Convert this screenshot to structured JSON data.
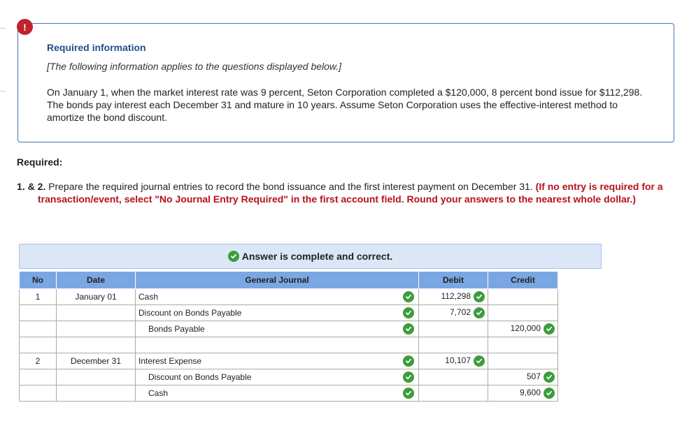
{
  "alert": {
    "icon": "exclamation-icon",
    "symbol": "!"
  },
  "info": {
    "title": "Required information",
    "note": "[The following information applies to the questions displayed below.]",
    "body": "On January 1, when the market interest rate was 9 percent, Seton Corporation completed a $120,000, 8 percent bond issue for $112,298. The bonds pay interest each December 31 and mature in 10 years. Assume Seton Corporation uses the effective-interest method to amortize the bond discount."
  },
  "required": {
    "heading": "Required:",
    "number": "1. & 2.",
    "text": " Prepare the required journal entries to record the bond issuance and the first interest payment on December 31. ",
    "instruction": "(If no entry is required for a transaction/event, select \"No Journal Entry Required\" in the first account field. Round your answers to the nearest whole dollar.)"
  },
  "answer": {
    "status": "Answer is complete and correct."
  },
  "journal": {
    "headers": {
      "no": "No",
      "date": "Date",
      "account": "General Journal",
      "debit": "Debit",
      "credit": "Credit"
    },
    "rows": [
      {
        "no": "1",
        "date": "January 01",
        "account": "Cash",
        "indent": false,
        "check": true,
        "debit": "112,298",
        "credit": ""
      },
      {
        "no": "",
        "date": "",
        "account": "Discount on Bonds Payable",
        "indent": false,
        "check": true,
        "debit": "7,702",
        "credit": ""
      },
      {
        "no": "",
        "date": "",
        "account": "Bonds Payable",
        "indent": true,
        "check": true,
        "debit": "",
        "credit": "120,000"
      },
      {
        "no": "",
        "date": "",
        "account": "",
        "indent": false,
        "check": false,
        "debit": "",
        "credit": ""
      },
      {
        "no": "2",
        "date": "December 31",
        "account": "Interest Expense",
        "indent": false,
        "check": true,
        "debit": "10,107",
        "credit": ""
      },
      {
        "no": "",
        "date": "",
        "account": "Discount on Bonds Payable",
        "indent": true,
        "check": true,
        "debit": "",
        "credit": "507"
      },
      {
        "no": "",
        "date": "",
        "account": "Cash",
        "indent": true,
        "check": true,
        "debit": "",
        "credit": "9,600"
      }
    ]
  },
  "colors": {
    "check": "#3c9d3c",
    "header": "#7aa7e3",
    "banner": "#dbe7f6",
    "red": "#b5121b",
    "title": "#1f4e8c"
  }
}
